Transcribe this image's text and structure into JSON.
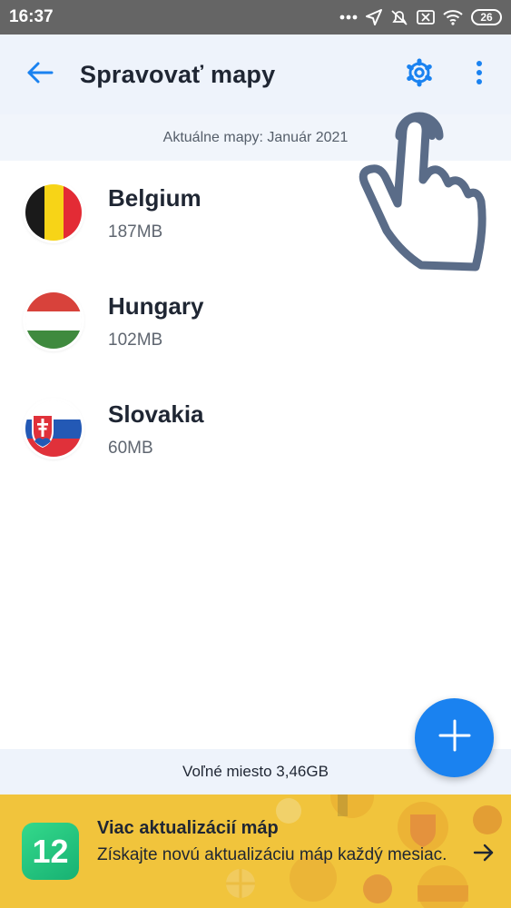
{
  "status_bar": {
    "time": "16:37",
    "battery": "26"
  },
  "app_bar": {
    "title": "Spravovať mapy",
    "back_icon": "arrow-left-icon",
    "settings_icon": "gear-icon",
    "more_icon": "more-vertical-icon"
  },
  "info": {
    "text": "Aktuálne mapy: Január 2021"
  },
  "maps": [
    {
      "country": "Belgium",
      "size": "187MB",
      "flag": "belgium-flag-icon"
    },
    {
      "country": "Hungary",
      "size": "102MB",
      "flag": "hungary-flag-icon"
    },
    {
      "country": "Slovakia",
      "size": "60MB",
      "flag": "slovakia-flag-icon"
    }
  ],
  "storage": {
    "text": "Voľné miesto 3,46GB"
  },
  "promo": {
    "badge": "12",
    "title": "Viac aktualizácií máp",
    "text": "Získajte novú aktualizáciu máp každý mesiac."
  },
  "colors": {
    "accent": "#1a82f0",
    "app_bar_bg": "#eef3fb",
    "promo_bg": "#f1c43c",
    "status_bar_bg": "#656565"
  }
}
